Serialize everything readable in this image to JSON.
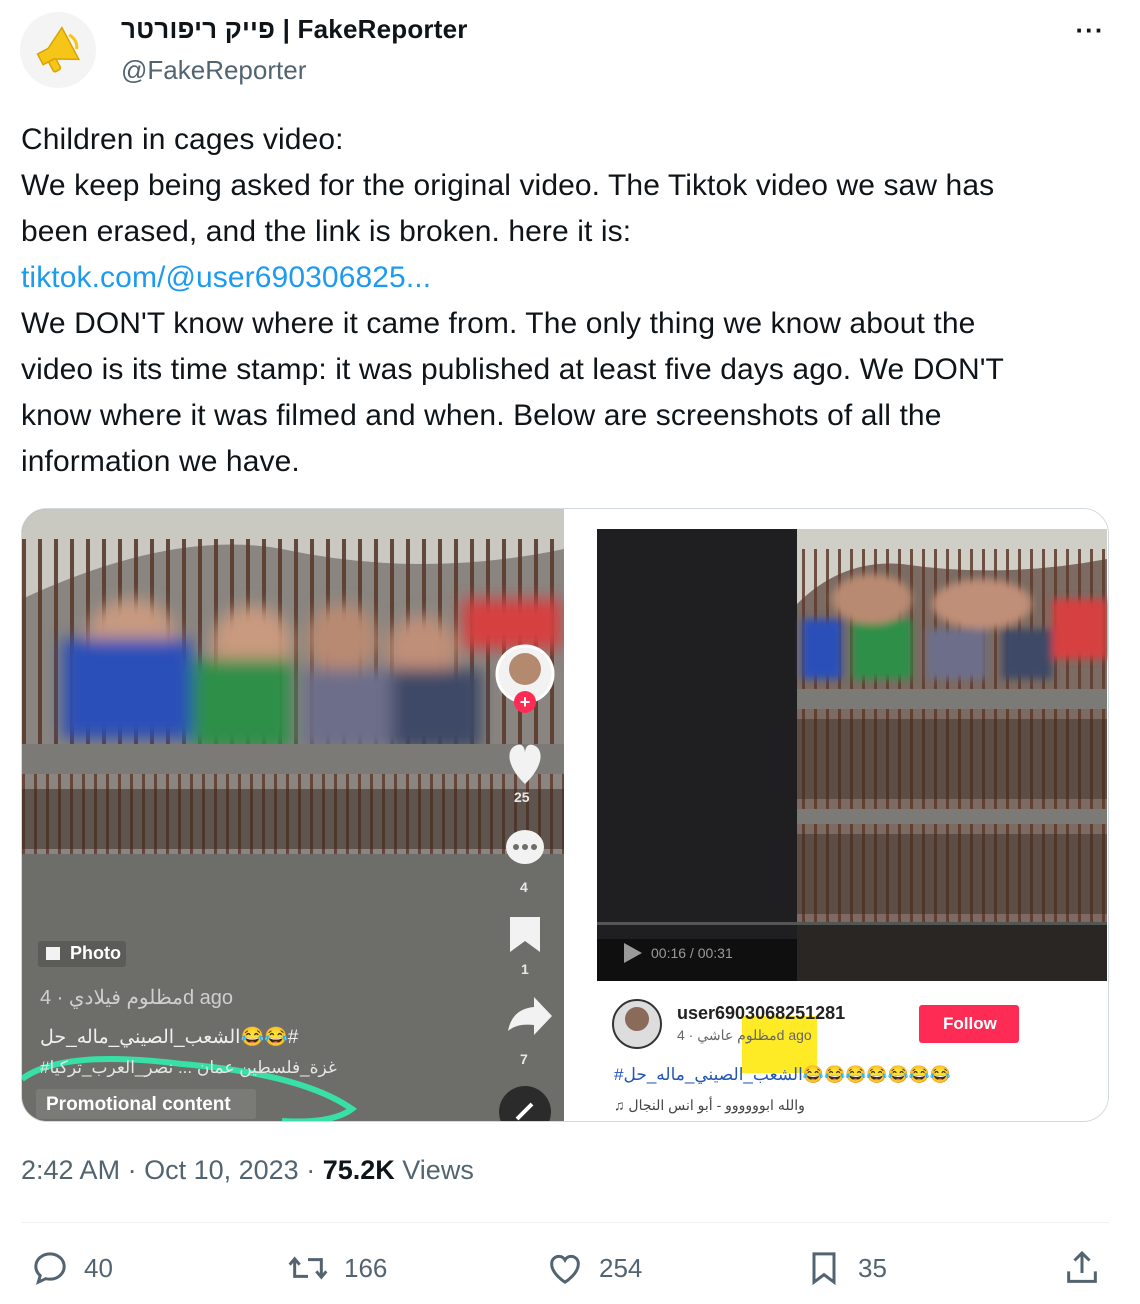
{
  "author": {
    "display_name": "פייק ריפורטר | FakeReporter",
    "handle": "@FakeReporter",
    "avatar_icon": "megaphone-icon"
  },
  "more_label": "···",
  "text": {
    "line1": "Children in cages video:",
    "line2": "We keep being asked for the original video. The Tiktok video we saw has",
    "line3": "been erased, and the link is broken. here it is:",
    "link": "tiktok.com/@user690306825...",
    "line5": "We DON'T know where it came from. The only thing we know about the",
    "line6": "video is its time stamp: it was published at least five days ago. We DON'T",
    "line7": "know where it was filmed and when. Below are screenshots of all the",
    "line8": "information we have."
  },
  "media": {
    "left": {
      "likes": "25",
      "comments": "4",
      "saves": "1",
      "shares": "7",
      "photo_label": "Photo",
      "user_line": "مظلوم فيلادي · 4d ago",
      "hashtags1": "الشعب_الصيني_ماله_حل😂😂#",
      "hashtags2": "#غزة_فلسطين عمان ... نصر_العرب_تركيا",
      "promo": "Promotional content"
    },
    "right": {
      "time": "00:16 / 00:31",
      "username": "user6903068251281",
      "sub": "مظلوم عاشي · 4d ago",
      "follow": "Follow",
      "hashtags": "#الشعب_الصيني_ماله_حل😂😂😂😂😂😂😂",
      "sound": "♫ والله ابوووووو - أبو انس النجال"
    }
  },
  "meta": {
    "time": "2:42 AM",
    "date": "Oct 10, 2023",
    "views_count": "75.2K",
    "views_label": "Views"
  },
  "actions": {
    "replies": "40",
    "reposts": "166",
    "likes": "254",
    "bookmarks": "35"
  },
  "colors": {
    "link": "#1d9bf0",
    "secondary": "#536471",
    "follow": "#fe2c55",
    "highlight": "#ffe600"
  }
}
